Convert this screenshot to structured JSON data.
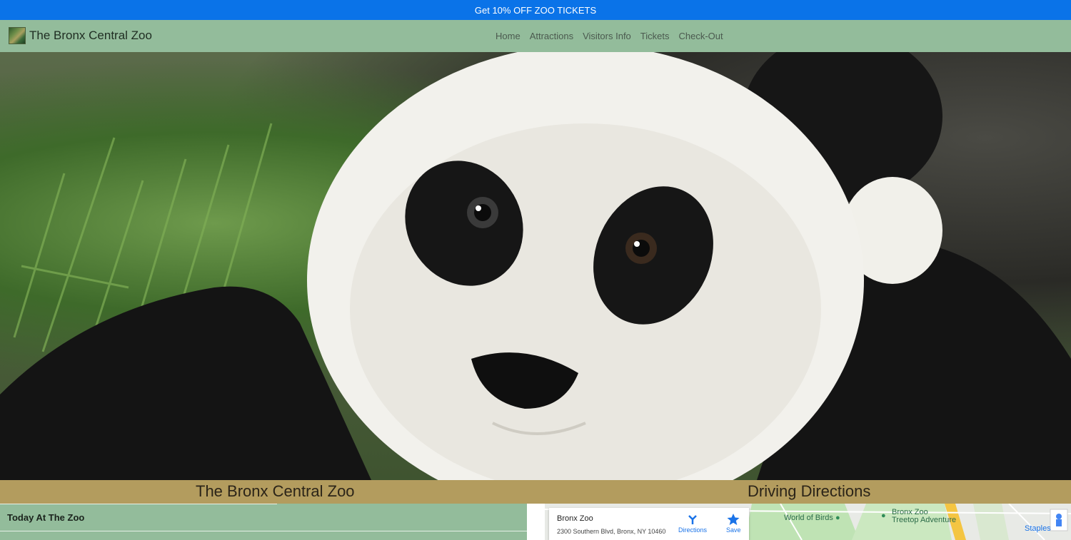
{
  "promo": {
    "text": "Get 10% OFF ZOO TICKETS"
  },
  "navbar": {
    "brand": "The Bronx Central Zoo",
    "links": [
      "Home",
      "Attractions",
      "Visitors Info",
      "Tickets",
      "Check-Out"
    ]
  },
  "sections": {
    "left_title": "The Bronx Central Zoo",
    "right_title": "Driving Directions"
  },
  "today": {
    "title": "Today At The Zoo"
  },
  "map": {
    "place_name": "Bronx Zoo",
    "address": "2300 Southern Blvd, Bronx, NY 10460",
    "directions_label": "Directions",
    "save_label": "Save",
    "poi_world_of_birds": "World of Birds",
    "poi_treetop_line1": "Bronx Zoo",
    "poi_treetop_line2": "Treetop Adventure",
    "poi_staples": "Staples"
  },
  "colors": {
    "promo_bg": "#0a73e8",
    "navbar_bg": "#93bc9b",
    "section_band": "#b39c5e",
    "map_link": "#1a73e8"
  }
}
